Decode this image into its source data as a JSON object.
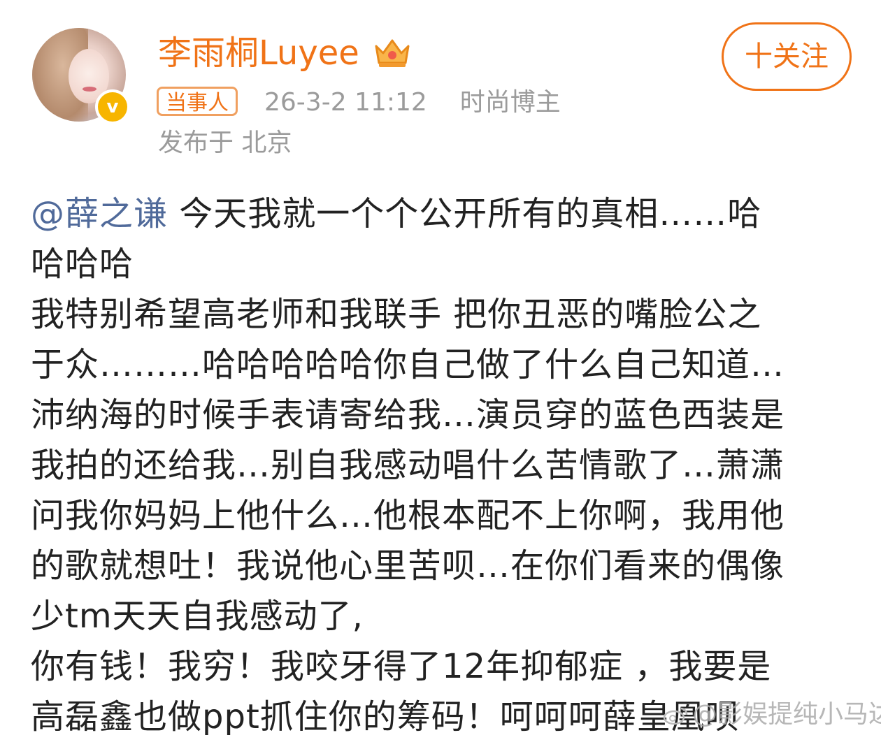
{
  "post_header": {
    "username": "李雨桐Luyee",
    "badge": "当事人",
    "timestamp": "26-3-2 11:12",
    "category": "时尚博主",
    "location": "发布于 北京",
    "follow_label": "十关注",
    "verified_mark": "v",
    "icons": [
      "crown-icon",
      "verified-icon"
    ],
    "colors": {
      "accent": "#f07317",
      "mention": "#506a9a",
      "meta": "#9b9b9b",
      "verified": "#f7b500"
    }
  },
  "post_body": {
    "mention": "@薛之谦",
    "lines": [
      " 今天我就一个个公开所有的真相……哈",
      "哈哈哈",
      "我特别希望高老师和我联手 把你丑恶的嘴脸公之",
      "于众………哈哈哈哈哈你自己做了什么自己知道…",
      "沛纳海的时候手表请寄给我…演员穿的蓝色西装是",
      "我拍的还给我…别自我感动唱什么苦情歌了…萧潇",
      "问我你妈妈上他什么…他根本配不上你啊，我用他",
      "的歌就想吐！我说他心里苦呗…在你们看来的偶像",
      "少tm天天自我感动了,",
      "你有钱！我穷！我咬牙得了12年抑郁症 ，我要是",
      "高磊鑫也做ppt抓住你的筹码！呵呵呵薛皇凰呗"
    ]
  },
  "watermark": {
    "text": "@影娱提纯小马达",
    "icon": "weibo-logo-icon"
  }
}
